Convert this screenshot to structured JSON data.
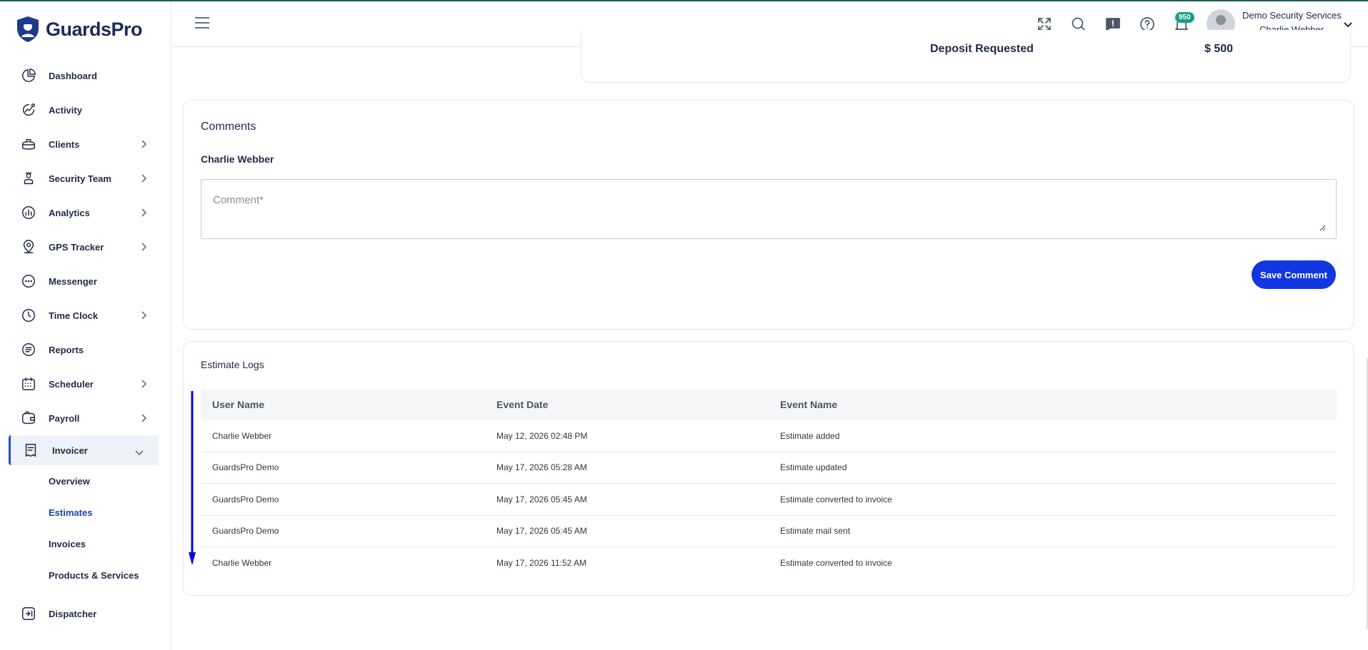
{
  "app": {
    "name": "GuardsPro"
  },
  "sidebar": {
    "items": [
      {
        "label": "Dashboard",
        "icon": "dashboard-icon",
        "has_children": false
      },
      {
        "label": "Activity",
        "icon": "activity-icon",
        "has_children": false
      },
      {
        "label": "Clients",
        "icon": "clients-icon",
        "has_children": true
      },
      {
        "label": "Security Team",
        "icon": "security-team-icon",
        "has_children": true
      },
      {
        "label": "Analytics",
        "icon": "analytics-icon",
        "has_children": true
      },
      {
        "label": "GPS Tracker",
        "icon": "gps-icon",
        "has_children": true
      },
      {
        "label": "Messenger",
        "icon": "messenger-icon",
        "has_children": false
      },
      {
        "label": "Time Clock",
        "icon": "clock-icon",
        "has_children": true
      },
      {
        "label": "Reports",
        "icon": "reports-icon",
        "has_children": false
      },
      {
        "label": "Scheduler",
        "icon": "calendar-icon",
        "has_children": true
      },
      {
        "label": "Payroll",
        "icon": "payroll-icon",
        "has_children": true
      },
      {
        "label": "Invoicer",
        "icon": "invoice-icon",
        "has_children": true,
        "expanded": true
      }
    ],
    "invoicer_sub": [
      "Overview",
      "Estimates",
      "Invoices",
      "Products & Services"
    ],
    "current_sub": "Estimates",
    "after_items": [
      {
        "label": "Dispatcher",
        "icon": "dispatcher-icon"
      }
    ]
  },
  "header": {
    "notification_count": "950",
    "company": "Demo Security Services",
    "user": "Charlie Webber"
  },
  "summary": {
    "deposit_label": "Deposit Requested",
    "deposit_value": "$ 500"
  },
  "comments": {
    "title": "Comments",
    "author": "Charlie Webber",
    "placeholder": "Comment*",
    "save_label": "Save Comment"
  },
  "logs": {
    "title": "Estimate Logs",
    "columns": [
      "User Name",
      "Event Date",
      "Event Name"
    ],
    "rows": [
      [
        "Charlie Webber",
        "May 12, 2026 02:48 PM",
        "Estimate added"
      ],
      [
        "GuardsPro Demo",
        "May 17, 2026 05:28 AM",
        "Estimate updated"
      ],
      [
        "GuardsPro Demo",
        "May 17, 2026 05:45 AM",
        "Estimate converted to invoice"
      ],
      [
        "GuardsPro Demo",
        "May 17, 2026 05:45 AM",
        "Estimate mail sent"
      ],
      [
        "Charlie Webber",
        "May 17, 2026 11:52 AM",
        "Estimate converted to invoice"
      ]
    ]
  },
  "colors": {
    "accent": "#1237e0",
    "badge": "#16a085",
    "top_border": "#1c5e5a"
  }
}
